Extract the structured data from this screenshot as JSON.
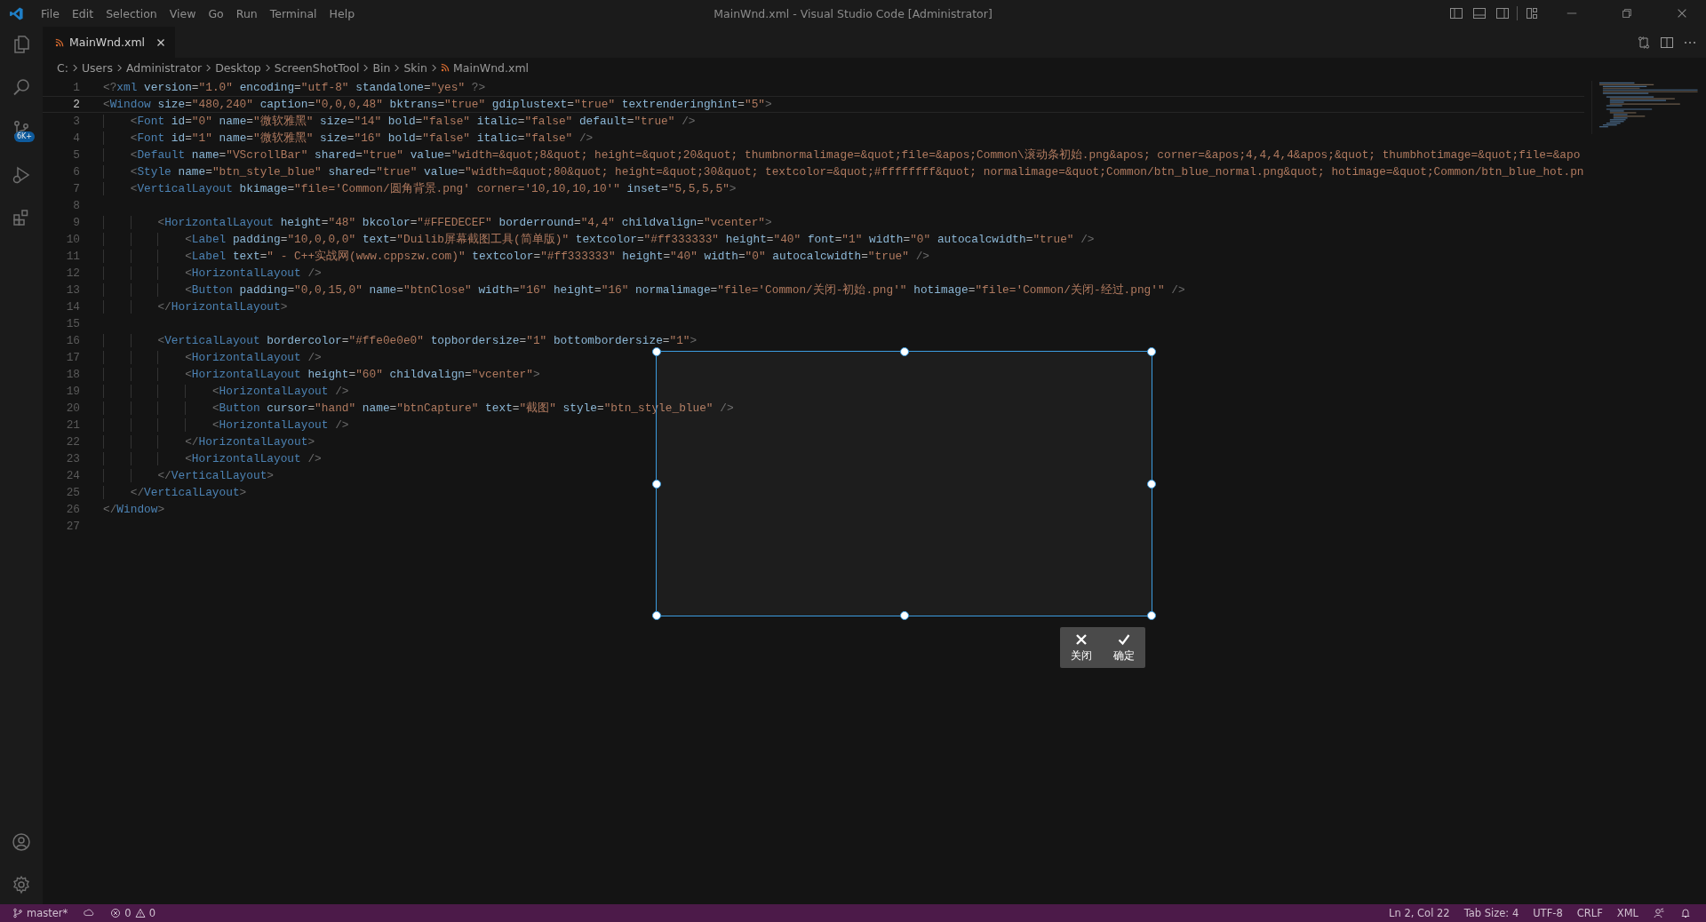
{
  "title_bar": {
    "menu": [
      "File",
      "Edit",
      "Selection",
      "View",
      "Go",
      "Run",
      "Terminal",
      "Help"
    ],
    "title": "MainWnd.xml - Visual Studio Code [Administrator]"
  },
  "activity_bar": {
    "source_control_badge": "6K+"
  },
  "tabs": [
    {
      "label": "MainWnd.xml",
      "selected": true
    }
  ],
  "breadcrumbs": [
    {
      "label": "C:",
      "kind": "folder"
    },
    {
      "label": "Users",
      "kind": "folder"
    },
    {
      "label": "Administrator",
      "kind": "folder"
    },
    {
      "label": "Desktop",
      "kind": "folder"
    },
    {
      "label": "ScreenShotTool",
      "kind": "folder"
    },
    {
      "label": "Bin",
      "kind": "folder"
    },
    {
      "label": "Skin",
      "kind": "folder"
    },
    {
      "label": "MainWnd.xml",
      "kind": "file"
    }
  ],
  "editor": {
    "lines": [
      {
        "number": "1",
        "text": "<?xml version=\"1.0\" encoding=\"utf-8\" standalone=\"yes\" ?>",
        "active": false
      },
      {
        "number": "2",
        "text": "<Window size=\"480,240\" caption=\"0,0,0,48\" bktrans=\"true\" gdiplustext=\"true\" textrenderinghint=\"5\">",
        "active": true
      },
      {
        "number": "3",
        "text": "    <Font id=\"0\" name=\"微软雅黑\" size=\"14\" bold=\"false\" italic=\"false\" default=\"true\" />",
        "active": false
      },
      {
        "number": "4",
        "text": "    <Font id=\"1\" name=\"微软雅黑\" size=\"16\" bold=\"false\" italic=\"false\" />",
        "active": false
      },
      {
        "number": "5",
        "text": "    <Default name=\"VScrollBar\" shared=\"true\" value=\"width=&quot;8&quot; height=&quot;20&quot; thumbnormalimage=&quot;file=&apos;Common\\滚动条初始.png&apos; corner=&apos;4,4,4,4&apos;&quot; thumbhotimage=&quot;file=&apo",
        "active": false
      },
      {
        "number": "6",
        "text": "    <Style name=\"btn_style_blue\" shared=\"true\" value=\"width=&quot;80&quot; height=&quot;30&quot; textcolor=&quot;#ffffffff&quot; normalimage=&quot;Common/btn_blue_normal.png&quot; hotimage=&quot;Common/btn_blue_hot.pn",
        "active": false
      },
      {
        "number": "7",
        "text": "    <VerticalLayout bkimage=\"file='Common/圆角背景.png' corner='10,10,10,10'\" inset=\"5,5,5,5\">",
        "active": false
      },
      {
        "number": "8",
        "active": false
      },
      {
        "number": "9",
        "text": "        <HorizontalLayout height=\"48\" bkcolor=\"#FFEDECEF\" borderround=\"4,4\" childvalign=\"vcenter\">",
        "active": false
      },
      {
        "number": "10",
        "text": "            <Label padding=\"10,0,0,0\" text=\"Duilib屏幕截图工具(简单版)\" textcolor=\"#ff333333\" height=\"40\" font=\"1\" width=\"0\" autocalcwidth=\"true\" />",
        "active": false
      },
      {
        "number": "11",
        "text": "            <Label text=\" - C++实战网(www.cppszw.com)\" textcolor=\"#ff333333\" height=\"40\" width=\"0\" autocalcwidth=\"true\" />",
        "active": false
      },
      {
        "number": "12",
        "text": "            <HorizontalLayout />",
        "active": false
      },
      {
        "number": "13",
        "text": "            <Button padding=\"0,0,15,0\" name=\"btnClose\" width=\"16\" height=\"16\" normalimage=\"file='Common/关闭-初始.png'\" hotimage=\"file='Common/关闭-经过.png'\" />",
        "active": false
      },
      {
        "number": "14",
        "text": "        </HorizontalLayout>",
        "active": false
      },
      {
        "number": "15",
        "active": false
      },
      {
        "number": "16",
        "text": "        <VerticalLayout bordercolor=\"#ffe0e0e0\" topbordersize=\"1\" bottombordersize=\"1\">",
        "active": false
      },
      {
        "number": "17",
        "text": "            <HorizontalLayout />",
        "active": false
      },
      {
        "number": "18",
        "text": "            <HorizontalLayout height=\"60\" childvalign=\"vcenter\">",
        "active": false
      },
      {
        "number": "19",
        "text": "                <HorizontalLayout />",
        "active": false
      },
      {
        "number": "20",
        "text": "                <Button cursor=\"hand\" name=\"btnCapture\" text=\"截图\" style=\"btn_style_blue\" />",
        "active": false
      },
      {
        "number": "21",
        "text": "                <HorizontalLayout />",
        "active": false
      },
      {
        "number": "22",
        "text": "            </HorizontalLayout>",
        "active": false
      },
      {
        "number": "23",
        "text": "            <HorizontalLayout />",
        "active": false
      },
      {
        "number": "24",
        "text": "        </VerticalLayout>",
        "active": false
      },
      {
        "number": "25",
        "text": "    </VerticalLayout>",
        "active": false
      },
      {
        "number": "26",
        "text": "</Window>",
        "active": false
      },
      {
        "number": "27",
        "active": false
      }
    ]
  },
  "capture": {
    "toolbar": [
      {
        "kind": "close",
        "label": "关闭"
      },
      {
        "kind": "confirm",
        "label": "确定"
      }
    ]
  },
  "status_bar": {
    "branch": "master*",
    "errors": "0",
    "warnings": "0",
    "position": "Ln 2, Col 22",
    "tab_size": "Tab Size: 4",
    "encoding": "UTF-8",
    "line_ending": "CRLF",
    "language": "XML"
  }
}
